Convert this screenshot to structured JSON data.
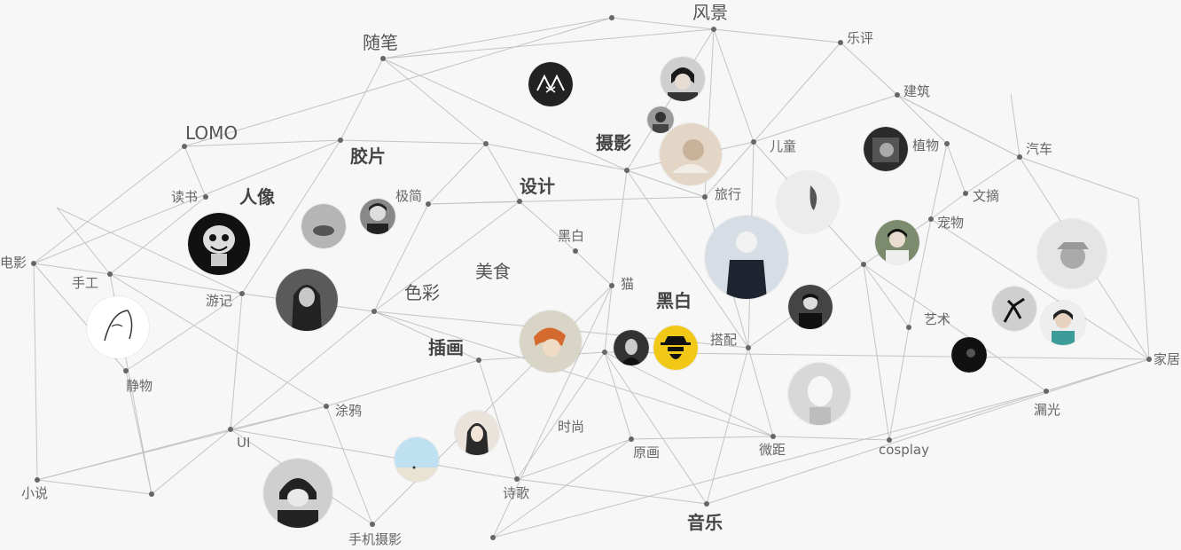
{
  "tags": {
    "fengjing": "风景",
    "suibi": "随笔",
    "lepin": "乐评",
    "jianzhu": "建筑",
    "lomo": "LOMO",
    "jiaopian": "胶片",
    "sheying": "摄影",
    "ertong": "儿童",
    "zhiwu": "植物",
    "qiche": "汽车",
    "dushu": "读书",
    "renxiang": "人像",
    "jijian": "极简",
    "sheji": "设计",
    "lvxing": "旅行",
    "wenzhai": "文摘",
    "chongwu": "宠物",
    "dianying": "电影",
    "heibai_small": "黑白",
    "shougong": "手工",
    "meishi": "美食",
    "mao": "猫",
    "youji": "游记",
    "secai": "色彩",
    "heibai_big": "黑白",
    "yishu": "艺术",
    "dapei": "搭配",
    "jiaju": "家居",
    "chahua": "插画",
    "jingwu": "静物",
    "tuya": "涂鸦",
    "louguang": "漏光",
    "shishang": "时尚",
    "ui": "UI",
    "yuanhua": "原画",
    "weiju": "微距",
    "cosplay": "cosplay",
    "xiaoshuo": "小说",
    "shige": "诗歌",
    "yinyue": "音乐",
    "shoujisheying": "手机摄影"
  }
}
